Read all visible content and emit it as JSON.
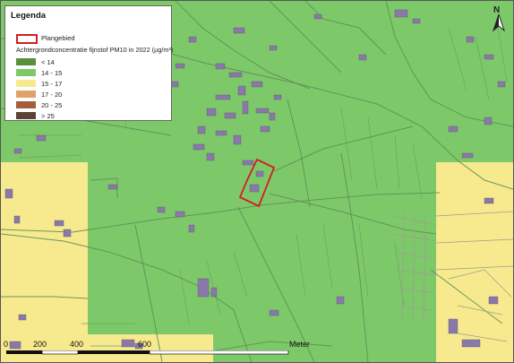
{
  "legend": {
    "title": "Legenda",
    "plangebied_label": "Plangebied",
    "concentration_title": "Achtergrondconcentratie fijnstof PM10 in 2022 (µg/m³)",
    "classes": [
      {
        "label": "< 14",
        "color": "#5a8f3e"
      },
      {
        "label": "14 - 15",
        "color": "#7dc96a"
      },
      {
        "label": "15 - 17",
        "color": "#f7e98e"
      },
      {
        "label": "17 - 20",
        "color": "#e2a169"
      },
      {
        "label": "20 - 25",
        "color": "#a65d3c"
      },
      {
        "label": "> 25",
        "color": "#5c4235"
      }
    ],
    "plangebied_color": "#d11f1f"
  },
  "map": {
    "green_color": "#7dc96a",
    "yellow_color": "#f7e98e",
    "road_color": "#6a9a5a",
    "building_color": "#8a79a8"
  },
  "north_arrow": {
    "label": "N",
    "icon": "north-arrow-icon"
  },
  "scalebar": {
    "ticks": [
      "0",
      "200",
      "400",
      "600"
    ],
    "unit": "Meter"
  }
}
